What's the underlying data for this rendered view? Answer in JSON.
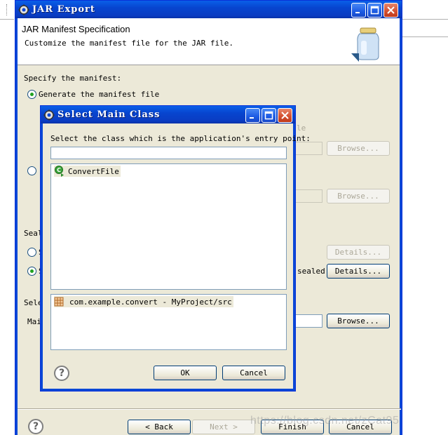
{
  "jar_window": {
    "title": "JAR Export",
    "header_title": "JAR Manifest Specification",
    "header_subtitle": "Customize the manifest file for the JAR file.",
    "specify_label": "Specify the manifest:",
    "generate_radio": "Generate the manifest file",
    "save_fragment": "le",
    "browse1": "Browse...",
    "browse2": "Browse...",
    "seal_fragment": "Seal",
    "radio_s1": "S",
    "radio_s2": "S",
    "details1": "Details...",
    "sealed_fragment": "sealed",
    "details2": "Details...",
    "select_fragment": "Sele",
    "main_fragment": "Mai",
    "browse3": "Browse...",
    "back": "< Back",
    "next": "Next >",
    "finish": "Finish",
    "cancel": "Cancel"
  },
  "dialog": {
    "title": "Select Main Class",
    "prompt": "Select the class which is the application's entry point:",
    "filter_value": "",
    "classes": [
      "ConvertFile"
    ],
    "packages": [
      "com.example.convert - MyProject/src"
    ],
    "ok": "OK",
    "cancel": "Cancel"
  },
  "watermark": "https://blog.csdn.net/zCat95",
  "colors": {
    "titlebar": "#0a47d6",
    "dialog_bg": "#ece9d8",
    "radio_dot": "#21a121"
  }
}
